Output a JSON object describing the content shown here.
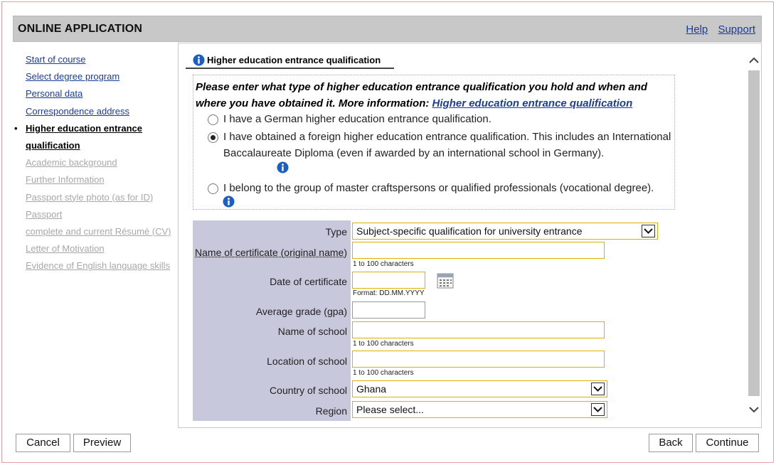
{
  "app": {
    "title": "ONLINE APPLICATION",
    "help_link": "Help",
    "support_link": "Support"
  },
  "sidebar": {
    "items": [
      {
        "label": "Start of course",
        "state": "link"
      },
      {
        "label": "Select degree program",
        "state": "link"
      },
      {
        "label": "Personal data",
        "state": "link"
      },
      {
        "label": "Correspondence address",
        "state": "link"
      },
      {
        "label": "Higher education entrance qualification",
        "state": "active"
      },
      {
        "label": "Academic background",
        "state": "disabled"
      },
      {
        "label": "Further Information",
        "state": "disabled"
      },
      {
        "label": "Passport style photo (as for ID)",
        "state": "disabled"
      },
      {
        "label": "Passport",
        "state": "disabled"
      },
      {
        "label": "complete and current Résumé (CV)",
        "state": "disabled"
      },
      {
        "label": "Letter of Motivation",
        "state": "disabled"
      },
      {
        "label": "Evidence of English language skills",
        "state": "disabled"
      }
    ],
    "active_bullet": "•",
    "active_line1": "Higher education entrance",
    "active_line2": "qualification"
  },
  "section": {
    "tab_label": "Higher education entrance qualification",
    "question_text": "Please enter what type of higher education entrance qualification you hold and when and where you have obtained it. More information: ",
    "question_link": "Higher education entrance qualification",
    "options": [
      {
        "label": "I have a German higher education entrance qualification.",
        "checked": false
      },
      {
        "label": "I have obtained a foreign higher education entrance qualification. This includes an International Baccalaureate Diploma (even if awarded by an international school in Germany).",
        "checked": true
      },
      {
        "label": "I belong to the group of master craftspersons or qualified professionals (vocational degree).",
        "checked": false
      }
    ]
  },
  "form": {
    "type_label": "Type",
    "type_value": "Subject-specific qualification for university entrance",
    "certificate_label": "Name of certificate (original name)",
    "certificate_value": "",
    "certificate_hint": "1 to 100 characters",
    "date_label": "Date of certificate",
    "date_value": "",
    "date_hint": "Format: DD.MM.YYYY",
    "grade_label": "Average grade (gpa)",
    "grade_value": "",
    "school_name_label": "Name of school",
    "school_name_value": "",
    "school_name_hint": "1 to 100 characters",
    "school_location_label": "Location of school",
    "school_location_value": "",
    "school_location_hint": "1 to 100 characters",
    "country_label": "Country of school",
    "country_value": "Ghana",
    "region_label": "Region",
    "region_value": "Please select..."
  },
  "footer": {
    "cancel": "Cancel",
    "preview": "Preview",
    "back": "Back",
    "continue": "Continue"
  },
  "colors": {
    "link": "#1a3c9c",
    "title_bar": "#c8c8c8",
    "form_label_bg": "#c8c8dc",
    "field_border": "#e0b000",
    "info_icon": "#1a5fc4"
  }
}
